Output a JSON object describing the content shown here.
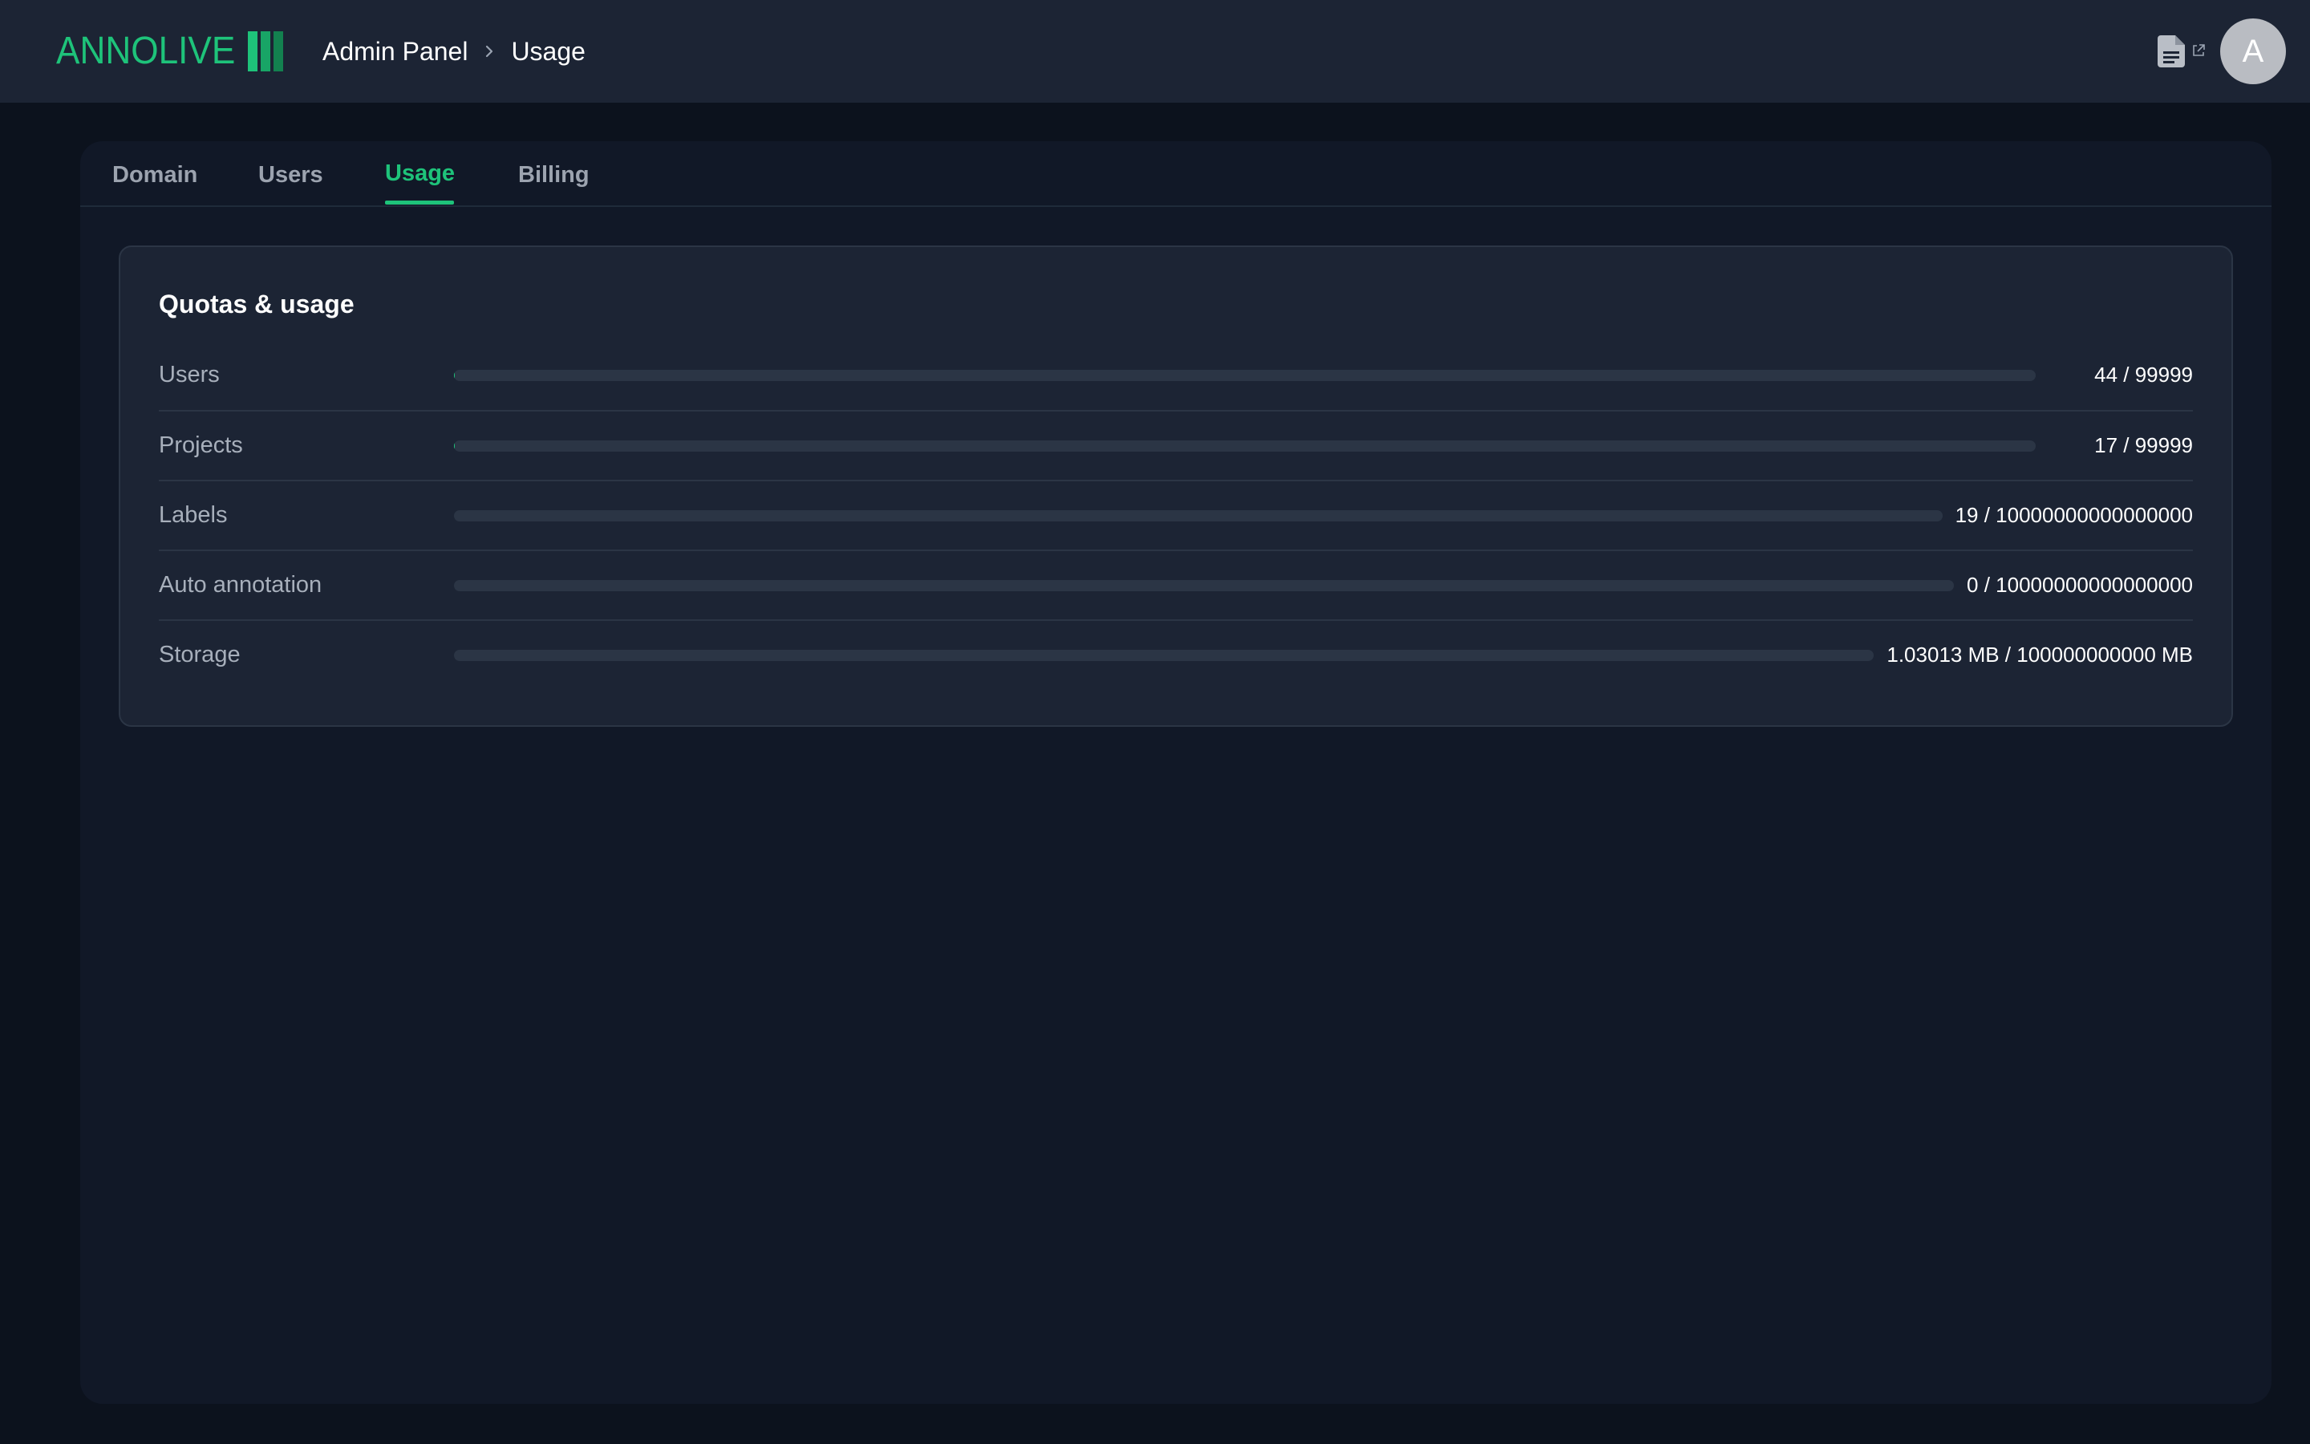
{
  "header": {
    "logo_text": "ANNOLIVE",
    "breadcrumb": [
      "Admin Panel",
      "Usage"
    ],
    "docs_icon": "document-icon",
    "external_icon": "external-link-icon",
    "avatar_initial": "A"
  },
  "tabs": [
    {
      "label": "Domain",
      "active": false
    },
    {
      "label": "Users",
      "active": false
    },
    {
      "label": "Usage",
      "active": true
    },
    {
      "label": "Billing",
      "active": false
    }
  ],
  "quotas": {
    "title": "Quotas & usage",
    "rows": [
      {
        "label": "Users",
        "used": 44,
        "limit": 99999,
        "value_text": "44 / 99999"
      },
      {
        "label": "Projects",
        "used": 17,
        "limit": 99999,
        "value_text": "17 / 99999"
      },
      {
        "label": "Labels",
        "used": 19,
        "limit": 10000000000000000,
        "value_text": "19 / 10000000000000000"
      },
      {
        "label": "Auto annotation",
        "used": 0,
        "limit": 10000000000000000,
        "value_text": "0 / 10000000000000000"
      },
      {
        "label": "Storage",
        "used": 1.03013,
        "limit": 100000000000,
        "value_text": "1.03013 MB / 100000000000 MB"
      }
    ]
  },
  "colors": {
    "accent": "#1ec37a",
    "background": "#0c121d",
    "topbar": "#1c2434",
    "panel": "#111827",
    "card": "#1c2434"
  }
}
